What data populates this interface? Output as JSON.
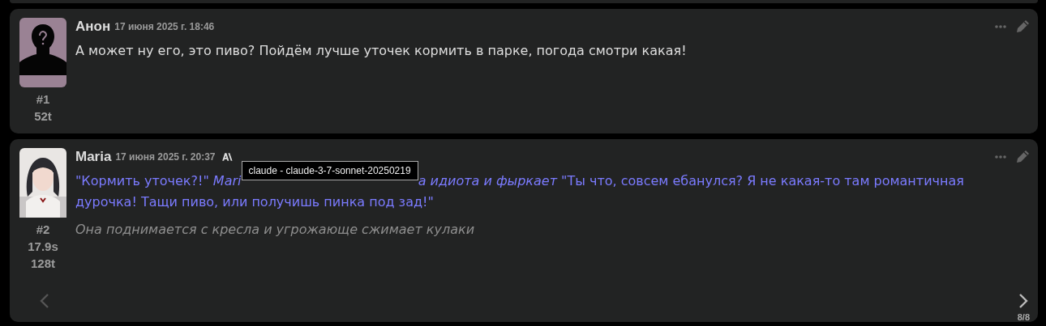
{
  "messages": [
    {
      "author": "Анон",
      "timestamp": "17 июня 2025 г. 18:46",
      "number": "#1",
      "stats": [
        "52t"
      ],
      "avatar": {
        "kind": "silhouette"
      },
      "paragraphs": [
        {
          "kind": "plain",
          "segments": [
            {
              "kind": "text",
              "text": "А может ну его, это пиво? Пойдём лучше уточек кормить в парке, погода смотри какая!"
            }
          ]
        }
      ]
    },
    {
      "author": "Maria",
      "timestamp": "17 июня 2025 г. 20:37",
      "number": "#2",
      "stats": [
        "17.9s",
        "128t"
      ],
      "model_badge": true,
      "paragraphs": [
        {
          "kind": "dialogue",
          "segments": [
            {
              "kind": "text",
              "text": "\"Кормить уточек?!\" *Mari*"
            },
            {
              "kind": "tooltip",
              "text": "claude - claude-3-7-sonnet-20250219"
            },
            {
              "kind": "text",
              "text": "*а идиота и фыркает* \"Ты что, совсем ебанулся? Я не какая-то там романтичная"
            },
            {
              "kind": "line",
              "text": "дурочка! Тащи пиво, или получишь пинка под зад!\""
            }
          ]
        },
        {
          "kind": "narration",
          "segments": [
            {
              "kind": "text",
              "text": "Она поднимается с кресла и угрожающе сжимает кулаки"
            }
          ]
        }
      ],
      "swipe": {
        "counter": "8/8",
        "prev_disabled": true
      }
    }
  ]
}
